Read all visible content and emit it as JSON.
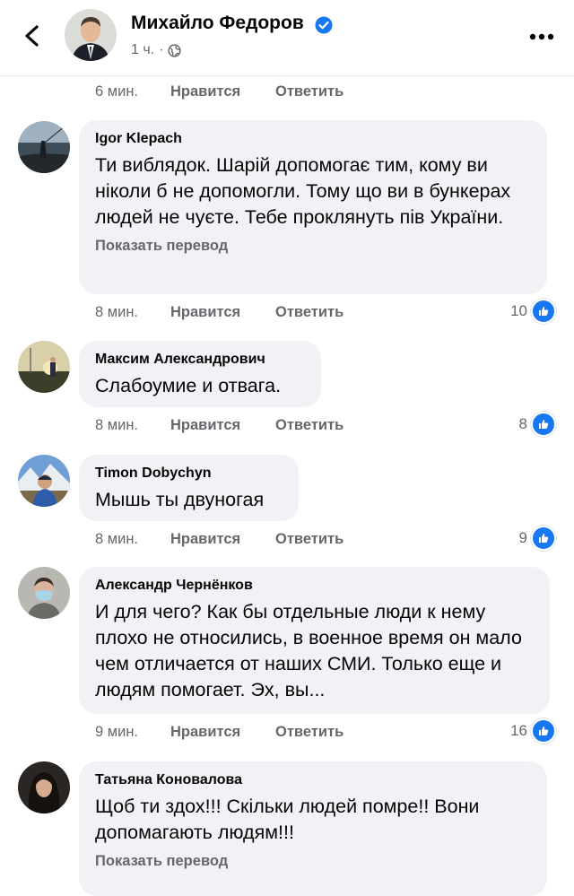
{
  "header": {
    "back_icon": "chevron-left-icon",
    "name": "Михайло Федоров",
    "verified_icon": "verified-badge-icon",
    "time": "1 ч.",
    "privacy_icon": "globe-icon",
    "more_icon": "more-horizontal-icon"
  },
  "top_meta": {
    "time": "6 мин.",
    "like": "Нравится",
    "reply": "Ответить"
  },
  "comments": [
    {
      "author": "Igor Klepach",
      "text": "Ти виблядок. Шарій допомогає тим, кому ви ніколи б не допомогли. Тому що ви в бункерах людей не чуєте. Тебе проклянуть пів України.",
      "translate": "Показать перевод",
      "time": "8 мин.",
      "like": "Нравится",
      "reply": "Ответить",
      "reactions": "10"
    },
    {
      "author": "Максим Александрович",
      "text": "Слабоумие и отвага.",
      "time": "8 мин.",
      "like": "Нравится",
      "reply": "Ответить",
      "reactions": "8"
    },
    {
      "author": "Timon Dobychyn",
      "text": "Мышь ты двуногая",
      "time": "8 мин.",
      "like": "Нравится",
      "reply": "Ответить",
      "reactions": "9"
    },
    {
      "author": "Александр Чернёнков",
      "text": "И для чего? Как бы отдельные люди к нему плохо не относились, в военное время он мало чем отличается от наших СМИ. Только еще и людям помогает. Эх, вы...",
      "time": "9 мин.",
      "like": "Нравится",
      "reply": "Ответить",
      "reactions": "16"
    },
    {
      "author": "Татьяна Коновалова",
      "text": "Щоб ти здох!!! Скільки людей помре!! Вони допомагають людям!!!",
      "translate": "Показать перевод"
    }
  ],
  "colors": {
    "accent": "#1877f2",
    "bubble": "#f0f2f5",
    "secondary_text": "#65676b"
  }
}
